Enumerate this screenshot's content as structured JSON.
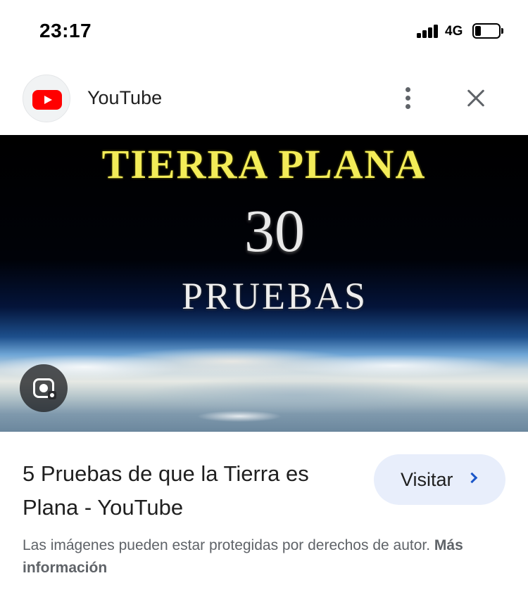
{
  "status_bar": {
    "time": "23:17",
    "network": "4G"
  },
  "header": {
    "site_name": "YouTube",
    "logo_icon": "youtube-logo-icon",
    "more_icon": "more-vert-icon",
    "close_icon": "close-icon"
  },
  "image": {
    "line1": "TIERRA PLANA",
    "line2": "30",
    "line3": "PRUEBAS",
    "lens_icon": "google-lens-icon"
  },
  "result": {
    "title": "5 Pruebas de que la Tierra es Plana - YouTube",
    "visit_label": "Visitar",
    "notice_text": "Las imágenes pueden estar protegidas por derechos de autor. ",
    "more_info_label": "Más información"
  },
  "colors": {
    "brand_red": "#ff0000",
    "visit_bg": "#e8eefb",
    "chevron": "#1a56c8",
    "title_yellow": "#f3ec58"
  }
}
